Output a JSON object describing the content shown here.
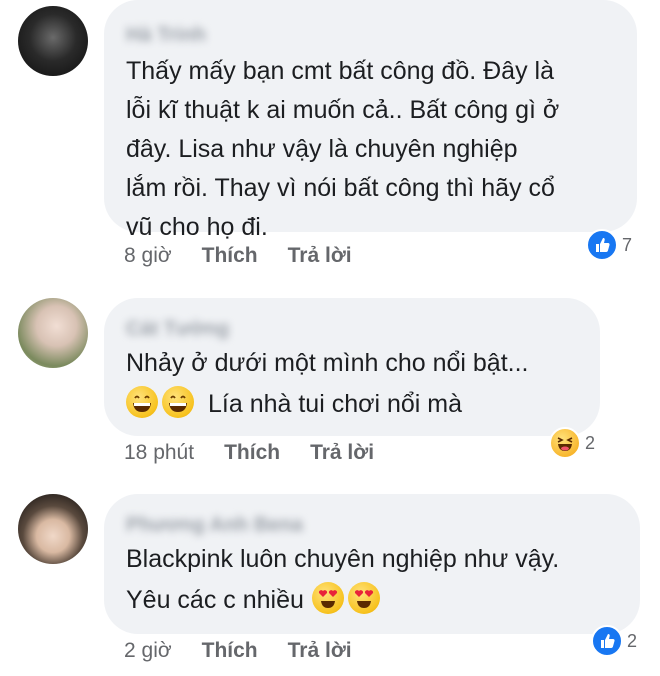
{
  "comments": [
    {
      "author": "Hà Trinh",
      "text_lines": [
        "Thấy mấy bạn cmt bất công đồ. Đây là",
        "lỗi kĩ thuật k ai muốn cả.. Bất công gì ở",
        "đây.  Lisa như vậy là chuyên nghiệp",
        "lắm rồi. Thay vì nói bất công thì hãy cổ",
        "vũ cho họ đi."
      ],
      "time": "8 giờ",
      "like_label": "Thích",
      "reply_label": "Trả lời",
      "reaction_icon": "like-icon",
      "reaction_count": "7",
      "reaction_color": "#1877f2"
    },
    {
      "author": "Cát Tường",
      "text_lines": [
        "Nhảy ở dưới một mình cho nổi bật...",
        "Lía nhà tui chơi nổi mà"
      ],
      "line2_emojis": [
        "grinning-face-emoji",
        "grinning-face-emoji"
      ],
      "time": "18 phút",
      "like_label": "Thích",
      "reply_label": "Trả lời",
      "reaction_icon": "haha-icon",
      "reaction_count": "2",
      "reaction_color": "#f7b125"
    },
    {
      "author": "Phương Anh Bena",
      "text_lines": [
        "Blackpink luôn chuyên nghiệp như vậy.",
        "Yêu các  c nhiều"
      ],
      "line2_emojis": [
        "heart-eyes-emoji",
        "heart-eyes-emoji"
      ],
      "time": "2 giờ",
      "like_label": "Thích",
      "reply_label": "Trả lời",
      "reaction_icon": "like-icon",
      "reaction_count": "2",
      "reaction_color": "#1877f2"
    }
  ]
}
